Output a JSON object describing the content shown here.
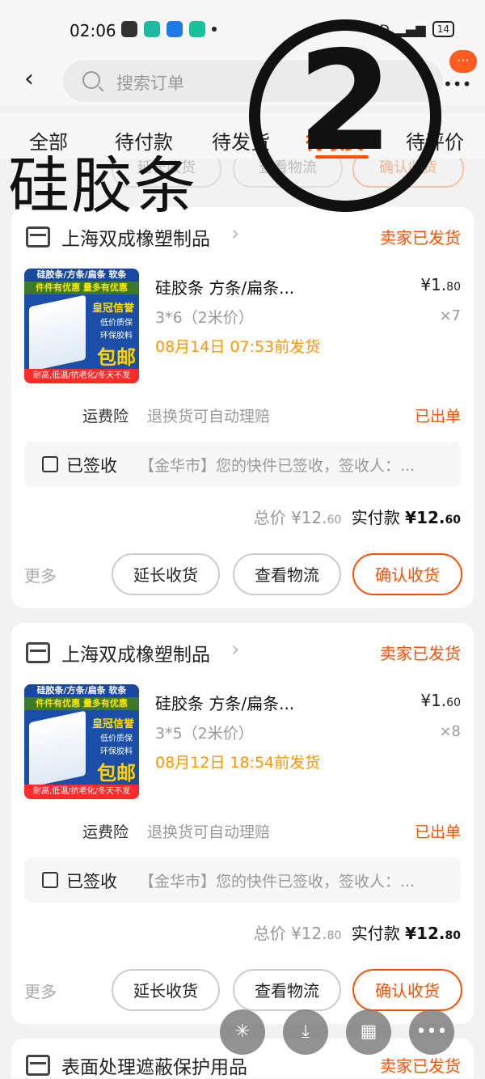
{
  "status_bar": {
    "time": "02:06",
    "right_text": "HD",
    "battery": "14"
  },
  "header": {
    "search_placeholder": "搜索订单",
    "badge": "···"
  },
  "tabs": [
    "全部",
    "待付款",
    "待发货",
    "待收货",
    "待评价"
  ],
  "active_tab": 3,
  "ghost_buttons": [
    "延长收货",
    "查看物流",
    "确认收货"
  ],
  "overlay": {
    "title": "硅胶条",
    "number": "2"
  },
  "thumbnail": {
    "top_band": "硅胶条/方条/扁条 软条",
    "sub_band": "件件有优惠 量多有优惠",
    "crown": "皇冠信誉",
    "feature1": "低价质保",
    "feature2": "环保胶料",
    "free_ship": "包邮",
    "bottom_band": "耐高,低温/抗老化/冬天不发"
  },
  "orders": [
    {
      "shop": "上海双成橡塑制品",
      "status": "卖家已发货",
      "item_title": "硅胶条 方条/扁条...",
      "spec": "3*6（2米价）",
      "ship_by": "08月14日 07:53前发货",
      "price_int": "¥1.",
      "price_dec": "80",
      "qty": "×7",
      "insurance_label": "运费险",
      "insurance_desc": "退换货可自动理赔",
      "insurance_status": "已出单",
      "logistics_label": "已签收",
      "logistics_text": "【金华市】您的快件已签收，签收人：...",
      "total_label": "总价",
      "total_int": "¥12.",
      "total_dec": "60",
      "paid_label": "实付款",
      "paid_int": "¥12.",
      "paid_dec": "60",
      "more": "更多",
      "btn_extend": "延长收货",
      "btn_track": "查看物流",
      "btn_confirm": "确认收货"
    },
    {
      "shop": "上海双成橡塑制品",
      "status": "卖家已发货",
      "item_title": "硅胶条 方条/扁条...",
      "spec": "3*5（2米价）",
      "ship_by": "08月12日 18:54前发货",
      "price_int": "¥1.",
      "price_dec": "60",
      "qty": "×8",
      "insurance_label": "运费险",
      "insurance_desc": "退换货可自动理赔",
      "insurance_status": "已出单",
      "logistics_label": "已签收",
      "logistics_text": "【金华市】您的快件已签收，签收人：...",
      "total_label": "总价",
      "total_int": "¥12.",
      "total_dec": "80",
      "paid_label": "实付款",
      "paid_int": "¥12.",
      "paid_dec": "80",
      "more": "更多",
      "btn_extend": "延长收货",
      "btn_track": "查看物流",
      "btn_confirm": "确认收货"
    },
    {
      "shop": "表面处理遮蔽保护用品",
      "status": "卖家已发货"
    }
  ],
  "floating_actions": [
    "sparkle-icon",
    "download-icon",
    "grid-icon",
    "more-icon"
  ],
  "colors": {
    "accent": "#ff5000",
    "ship_time": "#ff9500"
  }
}
